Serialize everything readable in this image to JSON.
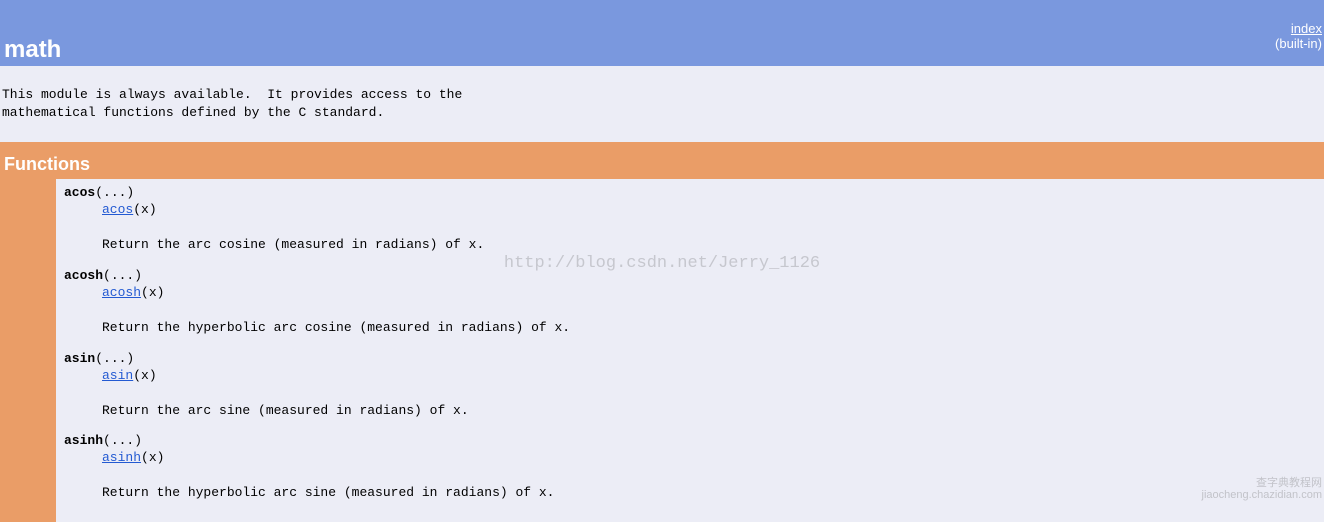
{
  "header": {
    "title": "math",
    "index_link": "index",
    "builtin": "(built-in)"
  },
  "module_description": "This module is always available.  It provides access to the\nmathematical functions defined by the C standard.",
  "section_title": "Functions",
  "functions": [
    {
      "name": "acos",
      "title_args": "(...)",
      "link": "acos",
      "sig_args": "(x)",
      "desc": "Return the arc cosine (measured in radians) of x."
    },
    {
      "name": "acosh",
      "title_args": "(...)",
      "link": "acosh",
      "sig_args": "(x)",
      "desc": "Return the hyperbolic arc cosine (measured in radians) of x."
    },
    {
      "name": "asin",
      "title_args": "(...)",
      "link": "asin",
      "sig_args": "(x)",
      "desc": "Return the arc sine (measured in radians) of x."
    },
    {
      "name": "asinh",
      "title_args": "(...)",
      "link": "asinh",
      "sig_args": "(x)",
      "desc": "Return the hyperbolic arc sine (measured in radians) of x."
    }
  ],
  "watermarks": {
    "center": "http://blog.csdn.net/Jerry_1126",
    "corner_top": "查字典教程网",
    "corner_bottom": "jiaocheng.chazidian.com"
  }
}
